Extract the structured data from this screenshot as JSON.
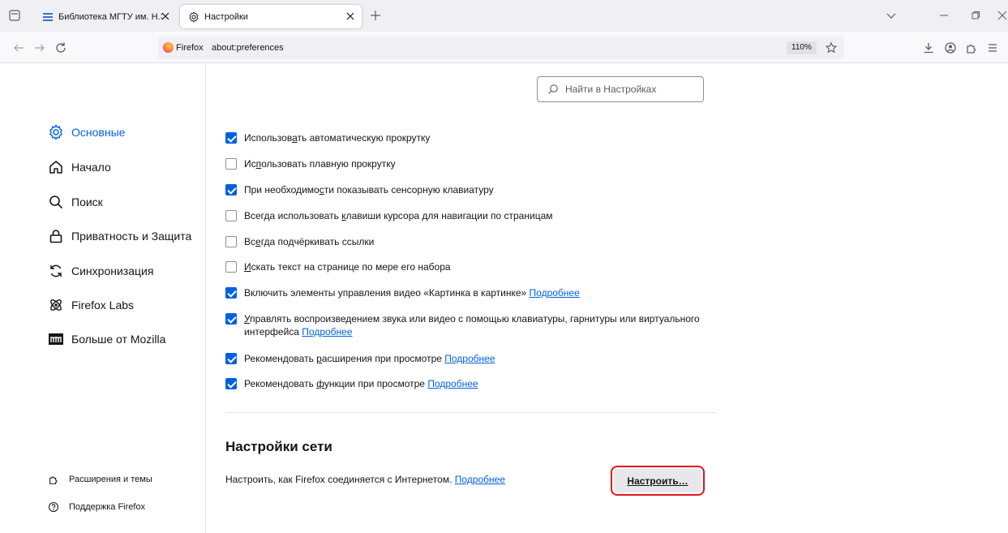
{
  "tabs": [
    {
      "title": "Библиотека МГТУ им. Н.Э. Баумана"
    },
    {
      "title": "Настройки"
    }
  ],
  "urlbar": {
    "identity": "Firefox",
    "url": "about:preferences",
    "zoom": "110%"
  },
  "search": {
    "placeholder": "Найти в Настройках"
  },
  "sidebar": {
    "categories": [
      {
        "label": "Основные",
        "icon": "gear-icon",
        "selected": true
      },
      {
        "label": "Начало",
        "icon": "home-icon"
      },
      {
        "label": "Поиск",
        "icon": "search-icon"
      },
      {
        "label": "Приватность и Защита",
        "icon": "lock-icon"
      },
      {
        "label": "Синхронизация",
        "icon": "sync-icon"
      },
      {
        "label": "Firefox Labs",
        "icon": "labs-icon"
      },
      {
        "label": "Больше от Mozilla",
        "icon": "mozilla-icon"
      }
    ],
    "footer": [
      {
        "label": "Расширения и темы",
        "icon": "extensions-icon"
      },
      {
        "label": "Поддержка Firefox",
        "icon": "help-icon"
      }
    ]
  },
  "options": [
    {
      "pre": "Использов",
      "u": "а",
      "post": "ть автоматическую прокрутку",
      "checked": true
    },
    {
      "pre": "Ис",
      "u": "п",
      "post": "ользовать плавную прокрутку",
      "checked": false
    },
    {
      "pre": "При необходимо",
      "u": "с",
      "post": "ти показывать сенсорную клавиатуру",
      "checked": true
    },
    {
      "pre": "Всегда использовать ",
      "u": "к",
      "post": "лавиши курсора для навигации по страницам",
      "checked": false
    },
    {
      "pre": "Вс",
      "u": "е",
      "post": "гда подчёркивать ссылки",
      "checked": false
    },
    {
      "pre": "",
      "u": "И",
      "post": "скать текст на странице по мере его набора",
      "checked": false
    },
    {
      "pre": "Включить элементы управления видео «Картинка в картинке» ",
      "u": "",
      "post": "",
      "link": "Подробнее",
      "checked": true
    },
    {
      "pre": "",
      "u": "У",
      "post": "правлять воспроизведением звука или видео с помощью клавиатуры, гарнитуры или виртуального интерфейса ",
      "link": "Подробнее",
      "checked": true
    },
    {
      "pre": "Рекомендовать ",
      "u": "р",
      "post": "асширения при просмотре ",
      "link": "Подробнее",
      "checked": true
    },
    {
      "pre": "Рекомендовать ",
      "u": "ф",
      "post": "ункции при просмотре ",
      "link": "Подробнее",
      "checked": true
    }
  ],
  "network": {
    "heading": "Настройки сети",
    "description": "Настроить, как Firefox соединяется с Интернетом. ",
    "link": "Подробнее",
    "button": "Настроить…"
  },
  "colors": {
    "accent": "#0061e0",
    "highlight": "#e0141d"
  }
}
